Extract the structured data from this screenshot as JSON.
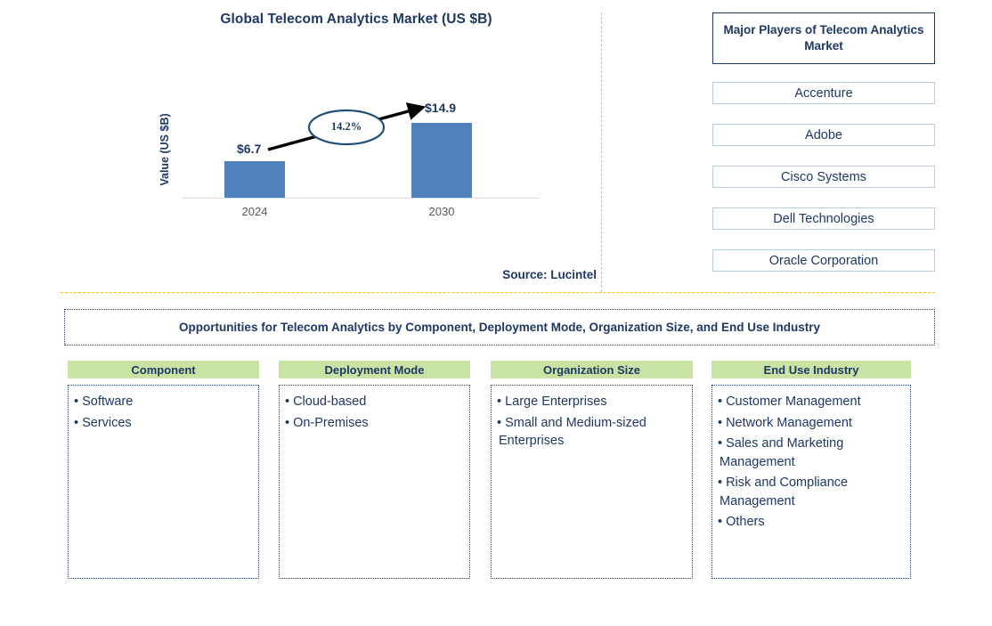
{
  "chart_data": {
    "type": "bar",
    "title": "Global Telecom Analytics Market (US $B)",
    "xlabel": "",
    "ylabel": "Value (US $B)",
    "categories": [
      "2024",
      "2030"
    ],
    "values": [
      6.7,
      14.9
    ],
    "value_labels": [
      "$6.7",
      "$14.9"
    ],
    "cagr_label": "14.2%",
    "ylim": [
      0,
      17.8
    ],
    "grid": false,
    "legend": null,
    "bar_color": "#4F81BD",
    "source": "Source: Lucintel"
  },
  "chart": {
    "title": "Global Telecom Analytics Market (US $B)",
    "y_axis_label": "Value (US $B)",
    "tick_2024": "2024",
    "tick_2030": "2030",
    "value_2024": "$6.7",
    "value_2030": "$14.9",
    "cagr": "14.2%",
    "source": "Source: Lucintel"
  },
  "players": {
    "title": "Major Players of Telecom Analytics Market",
    "items": [
      {
        "label": "Accenture"
      },
      {
        "label": "Adobe"
      },
      {
        "label": "Cisco Systems"
      },
      {
        "label": "Dell Technologies"
      },
      {
        "label": "Oracle Corporation"
      }
    ]
  },
  "opportunities": {
    "banner": "Opportunities for Telecom Analytics by Component, Deployment Mode, Organization Size, and End Use Industry",
    "columns": [
      {
        "header": "Component",
        "items": [
          "Software",
          "Services"
        ]
      },
      {
        "header": "Deployment Mode",
        "items": [
          "Cloud-based",
          "On-Premises"
        ]
      },
      {
        "header": "Organization Size",
        "items": [
          "Large Enterprises",
          "Small and Medium-sized Enterprises"
        ]
      },
      {
        "header": "End Use Industry",
        "items": [
          "Customer Management",
          "Network Management",
          "Sales and Marketing Management",
          "Risk and Compliance Management",
          "Others"
        ]
      }
    ]
  },
  "colors": {
    "bar": "#4F81BD",
    "navy": "#1F3864",
    "green_header": "#C9E3A5",
    "divider_orange": "#FFC000",
    "player_border": "#B8CCE4"
  },
  "bullet": "•"
}
